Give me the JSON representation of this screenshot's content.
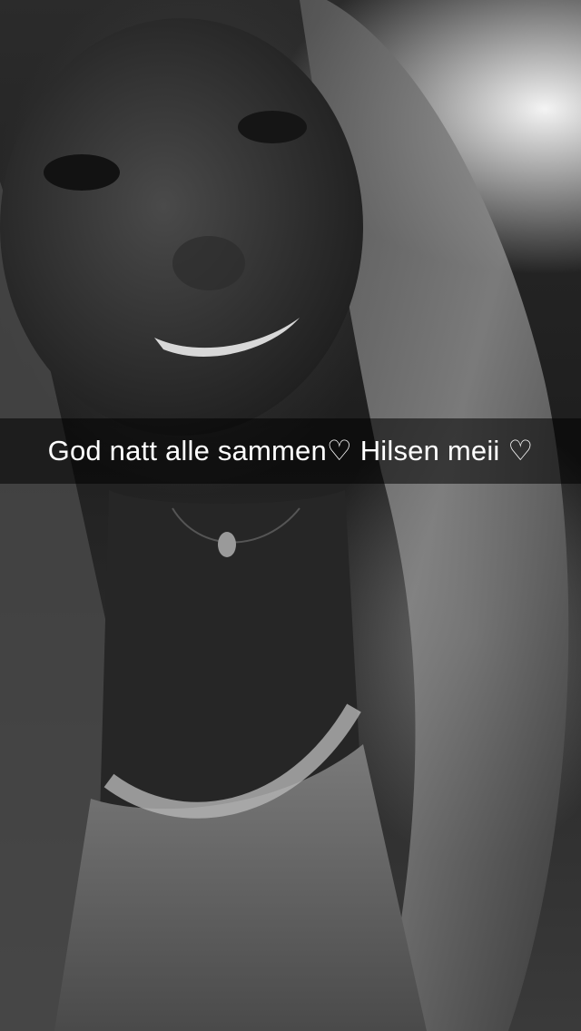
{
  "snap": {
    "caption": "God natt alle sammen♡ Hilsen meii ♡",
    "filter": "black-and-white",
    "caption_bar_color": "#000000",
    "caption_text_color": "#ffffff"
  }
}
